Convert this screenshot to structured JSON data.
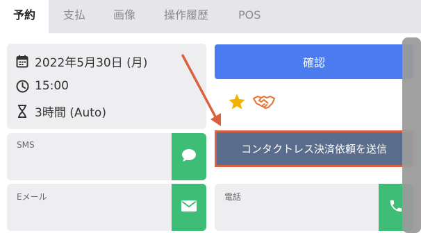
{
  "tabs": [
    {
      "label": "予約",
      "active": true
    },
    {
      "label": "支払",
      "active": false
    },
    {
      "label": "画像",
      "active": false
    },
    {
      "label": "操作履歴",
      "active": false
    },
    {
      "label": "POS",
      "active": false
    }
  ],
  "booking": {
    "date": "2022年5月30日 (月)",
    "time": "15:00",
    "duration": "3時間 (Auto)"
  },
  "actions": {
    "confirm_label": "確認",
    "send_label": "コンタクトレス決済依頼を送信"
  },
  "contacts": {
    "sms_label": "SMS",
    "email_label": "Eメール",
    "phone_label": "電話"
  },
  "colors": {
    "accent_blue": "#4a7cf0",
    "green": "#3dbd75",
    "send_button": "#5a6d8c",
    "highlight": "#d9613f",
    "star": "#f0b400"
  },
  "icons": {
    "date": "calendar-icon",
    "time": "clock-icon",
    "duration": "hourglass-icon",
    "favorite": "star-icon",
    "deal": "handshake-icon",
    "sms": "chat-bubble-icon",
    "email": "envelope-icon",
    "phone": "phone-icon"
  }
}
